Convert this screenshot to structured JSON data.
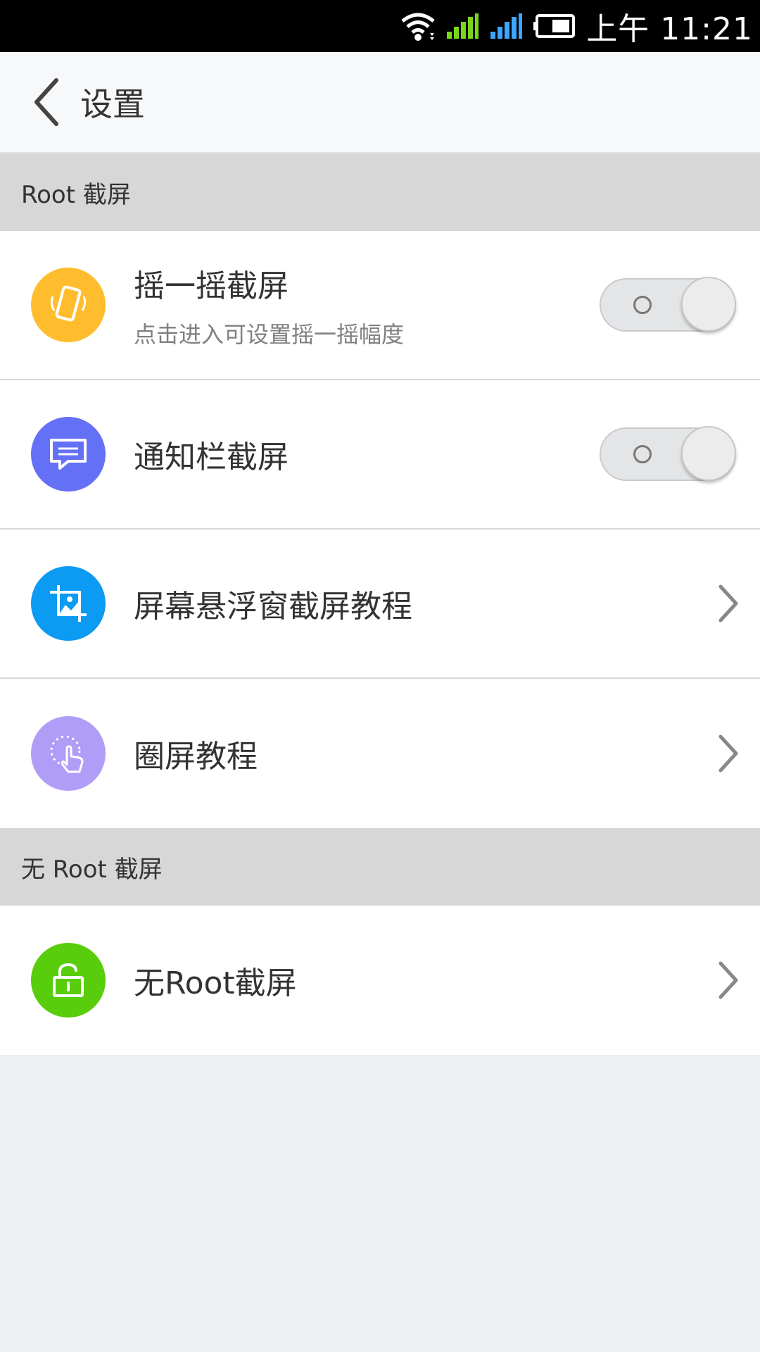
{
  "status_bar": {
    "time_prefix": "上午",
    "time": "11:21",
    "icons": [
      "wifi-icon",
      "signal-icon",
      "signal-icon-2",
      "battery-icon"
    ]
  },
  "app_bar": {
    "title": "设置"
  },
  "sections": [
    {
      "header": "Root 截屏",
      "items": [
        {
          "title": "摇一摇截屏",
          "subtitle": "点击进入可设置摇一摇幅度",
          "control": "toggle",
          "icon": "shake-phone-icon",
          "color": "#ffbd2e"
        },
        {
          "title": "通知栏截屏",
          "control": "toggle",
          "icon": "message-icon",
          "color": "#6470f5"
        },
        {
          "title": "屏幕悬浮窗截屏教程",
          "control": "chevron",
          "icon": "crop-image-icon",
          "color": "#0b9bf3"
        },
        {
          "title": "圈屏教程",
          "control": "chevron",
          "icon": "circle-gesture-icon",
          "color": "#b09df7"
        }
      ]
    },
    {
      "header": "无 Root 截屏",
      "items": [
        {
          "title": "无Root截屏",
          "control": "chevron",
          "icon": "unlock-icon",
          "color": "#58cd0c"
        }
      ]
    }
  ]
}
